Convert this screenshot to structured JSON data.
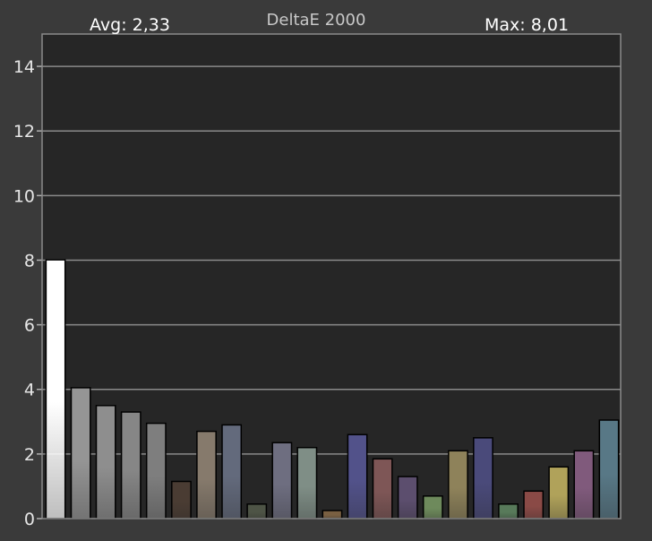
{
  "chart_data": {
    "type": "bar",
    "title": "DeltaE 2000",
    "avg_label": "Avg: 2,33",
    "max_label": "Max: 8,01",
    "ylim": [
      0,
      15
    ],
    "yticks": [
      0,
      2,
      4,
      6,
      8,
      10,
      12,
      14
    ],
    "grid": true,
    "background_color": "#3a3a3a",
    "plot_color": "#262626",
    "values": [
      8.01,
      4.05,
      3.5,
      3.3,
      2.95,
      1.15,
      2.7,
      2.9,
      0.45,
      2.35,
      2.2,
      0.25,
      2.6,
      1.85,
      1.3,
      0.7,
      2.1,
      2.5,
      0.45,
      0.85,
      1.6,
      2.1,
      3.05
    ],
    "colors": [
      "#ffffff",
      "#959595",
      "#8e8e8e",
      "#868686",
      "#7e7e7e",
      "#4a3c33",
      "#867a6c",
      "#636a7c",
      "#4e5446",
      "#6e6e80",
      "#7f8e86",
      "#7a6042",
      "#52528a",
      "#7e5656",
      "#5c4e6e",
      "#6e8a5c",
      "#8e825a",
      "#4a4a7a",
      "#587a5a",
      "#8a4a46",
      "#b0a25a",
      "#805a7c",
      "#587886"
    ]
  }
}
